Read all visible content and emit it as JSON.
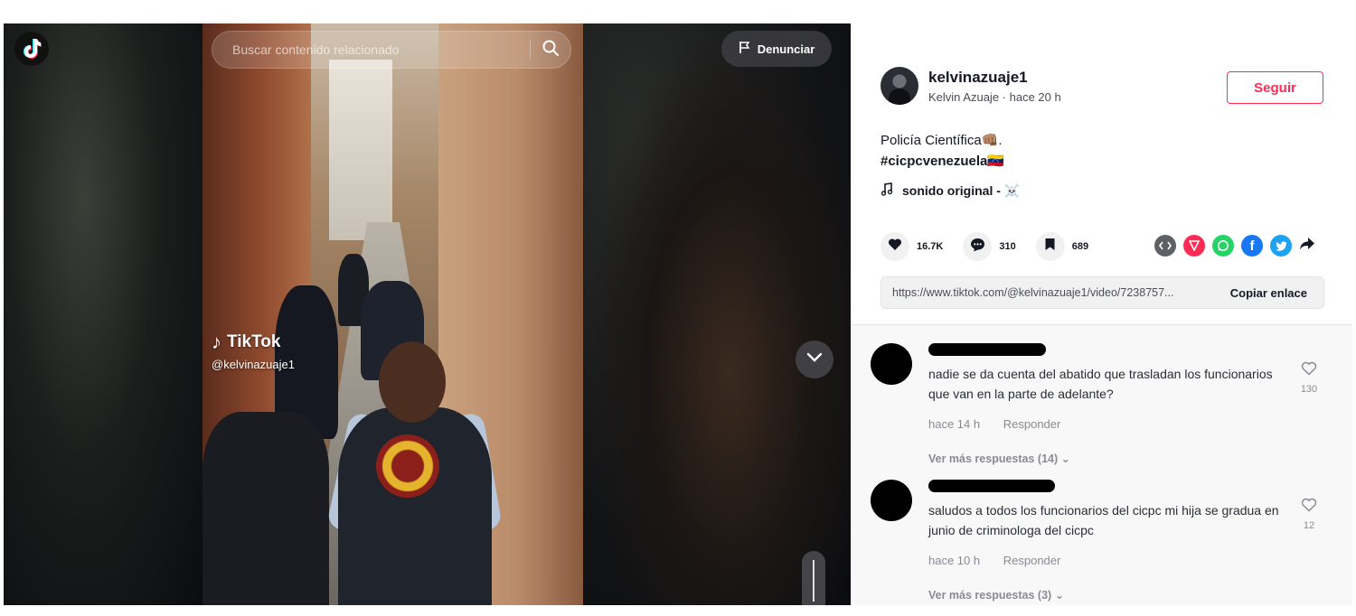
{
  "video": {
    "search_placeholder": "Buscar contenido relacionado",
    "report_label": "Denunciar",
    "watermark_brand": "TikTok",
    "watermark_user": "@kelvinazuaje1"
  },
  "post": {
    "author_username": "kelvinazuaje1",
    "author_meta": "Kelvin Azuaje · hace 20 h",
    "follow_label": "Seguir",
    "description_line1": "Policía Científica👊🏽.",
    "hashtag": "#cicpcvenezuela🇻🇪",
    "sound": "sonido original - ☠️",
    "likes": "16.7K",
    "comments_count": "310",
    "saves": "689",
    "link_url": "https://www.tiktok.com/@kelvinazuaje1/video/7238757...",
    "copy_label": "Copiar enlace"
  },
  "share_colors": {
    "embed": "#5f6065",
    "send": "#fe2c55",
    "whatsapp": "#25d366",
    "facebook": "#1877f2",
    "twitter": "#1da1f2"
  },
  "comments": [
    {
      "text": "nadie se da cuenta del abatido que trasladan los funcionarios que van en la parte de adelante?",
      "time": "hace 14 h",
      "reply": "Responder",
      "likes": "130",
      "more_replies": "Ver más respuestas (14)"
    },
    {
      "text": "saludos a todos los funcionarios del cicpc mi hija se gradua en junio de criminologa del cicpc",
      "time": "hace 10 h",
      "reply": "Responder",
      "likes": "12",
      "more_replies": "Ver más respuestas (3)"
    }
  ]
}
